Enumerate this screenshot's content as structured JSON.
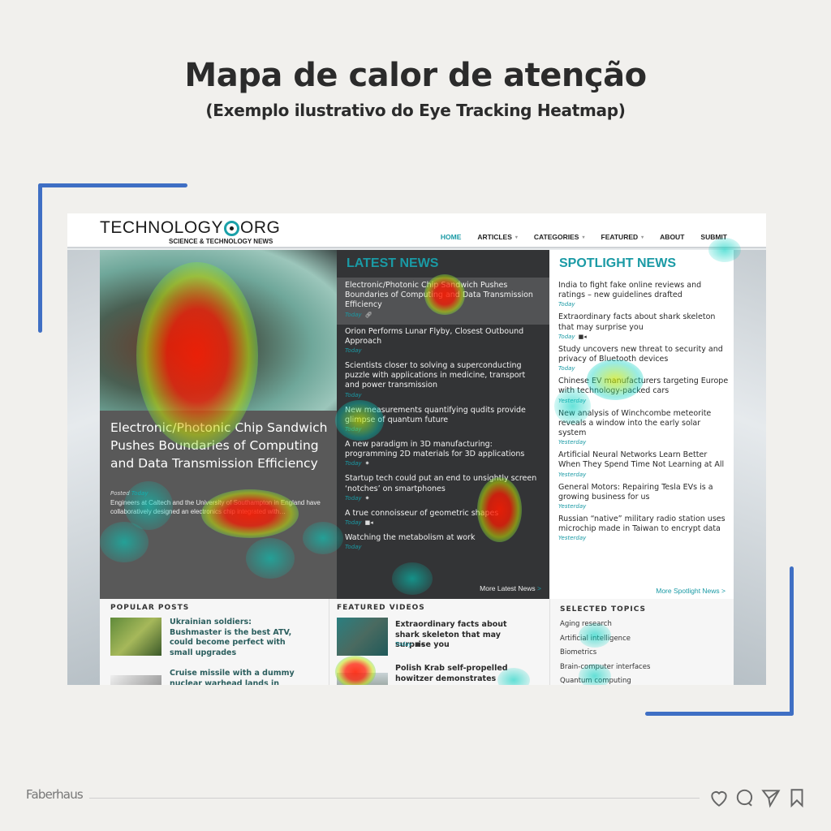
{
  "title": "Mapa de calor de atenção",
  "subtitle": "(Exemplo ilustrativo do Eye Tracking Heatmap)",
  "site": {
    "logo": {
      "left": "TECHNOLOGY",
      "right": "ORG",
      "tagline": "SCIENCE & TECHNOLOGY NEWS"
    },
    "nav": [
      {
        "label": "HOME",
        "active": true,
        "caret": false
      },
      {
        "label": "ARTICLES",
        "active": false,
        "caret": true
      },
      {
        "label": "CATEGORIES",
        "active": false,
        "caret": true
      },
      {
        "label": "FEATURED",
        "active": false,
        "caret": true
      },
      {
        "label": "ABOUT",
        "active": false,
        "caret": false
      },
      {
        "label": "SUBMIT",
        "active": false,
        "caret": false
      }
    ],
    "hero": {
      "title": "Electronic/Photonic Chip Sandwich Pushes Boundaries of Computing and Data Transmission Efficiency",
      "posted_label": "Posted",
      "posted_date": "Today",
      "excerpt": "Engineers at Caltech and the University of Southampton in England have collaboratively designed an electronics chip integrated with…"
    },
    "latest": {
      "heading": "LATEST NEWS",
      "items": [
        {
          "title": "Electronic/Photonic Chip Sandwich Pushes Boundaries of Computing and Data Transmission Efficiency",
          "date": "Today",
          "icon": "link-icon"
        },
        {
          "title": "Orion Performs Lunar Flyby, Closest Outbound Approach",
          "date": "Today",
          "icon": ""
        },
        {
          "title": "Scientists closer to solving a superconducting puzzle with applications in medicine, transport and power transmission",
          "date": "Today",
          "icon": ""
        },
        {
          "title": "New measurements quantifying qudits provide glimpse of quantum future",
          "date": "Today",
          "icon": ""
        },
        {
          "title": "A new paradigm in 3D manufacturing: programming 2D materials for 3D applications",
          "date": "Today",
          "icon": "idea-icon"
        },
        {
          "title": "Startup tech could put an end to unsightly screen ‘notches’ on smartphones",
          "date": "Today",
          "icon": "idea-icon"
        },
        {
          "title": "A true connoisseur of geometric shapes",
          "date": "Today",
          "icon": "video-icon"
        },
        {
          "title": "Watching the metabolism at work",
          "date": "Today",
          "icon": ""
        }
      ],
      "more": "More Latest News",
      "more_arrow": ">"
    },
    "spotlight": {
      "heading": "SPOTLIGHT NEWS",
      "items": [
        {
          "title": "India to fight fake online reviews and ratings – new guidelines drafted",
          "date": "Today",
          "icon": ""
        },
        {
          "title": "Extraordinary facts about shark skeleton that may surprise you",
          "date": "Today",
          "icon": "video-icon"
        },
        {
          "title": "Study uncovers new threat to security and privacy of Bluetooth devices",
          "date": "Today",
          "icon": ""
        },
        {
          "title": "Chinese EV manufacturers targeting Europe with technology-packed cars",
          "date": "Yesterday",
          "icon": ""
        },
        {
          "title": "New analysis of Winchcombe meteorite reveals a window into the early solar system",
          "date": "Yesterday",
          "icon": ""
        },
        {
          "title": "Artificial Neural Networks Learn Better When They Spend Time Not Learning at All",
          "date": "Yesterday",
          "icon": ""
        },
        {
          "title": "General Motors: Repairing Tesla EVs is a growing business for us",
          "date": "Yesterday",
          "icon": ""
        },
        {
          "title": "Russian “native” military radio station uses microchip made in Taiwan to encrypt data",
          "date": "Yesterday",
          "icon": ""
        }
      ],
      "more": "More Spotlight News >"
    },
    "popular": {
      "heading": "POPULAR POSTS",
      "items": [
        {
          "title": "Ukrainian soldiers: Bushmaster is the best ATV, could become perfect with small upgrades"
        },
        {
          "title": "Cruise missile with a dummy nuclear warhead lands in"
        }
      ]
    },
    "videos": {
      "heading": "FEATURED VIDEOS",
      "items": [
        {
          "title": "Extraordinary facts about shark skeleton that may surprise you",
          "date": "Today",
          "icon": "video-icon"
        },
        {
          "title": "Polish Krab self-propelled howitzer demonstrates"
        }
      ]
    },
    "topics": {
      "heading": "SELECTED TOPICS",
      "items": [
        "Aging research",
        "Artificial intelligence",
        "Biometrics",
        "Brain-computer interfaces",
        "Quantum computing"
      ]
    }
  },
  "heatmap": {
    "legend_colors": {
      "high": "#ff1a00",
      "mid": "#c8e600",
      "low": "#00d0c0"
    }
  },
  "footer": {
    "brand": "Faberhaus",
    "icons": [
      "heart-icon",
      "comment-icon",
      "send-icon",
      "bookmark-icon"
    ]
  },
  "colors": {
    "accent": "#1a9aa5",
    "bracket": "#3f6fc4"
  }
}
